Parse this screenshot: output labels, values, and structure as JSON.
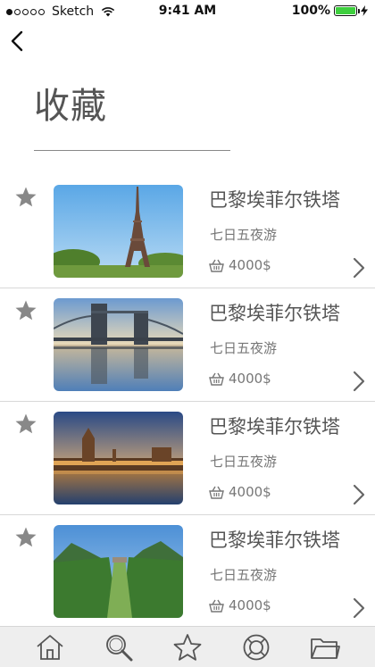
{
  "status_bar": {
    "carrier": "Sketch",
    "time": "9:41 AM",
    "battery": "100%",
    "signal_bars_filled": 1,
    "signal_bars_total": 5
  },
  "nav": {
    "back_icon": "chevron-left-icon"
  },
  "page": {
    "title": "收藏"
  },
  "items": [
    {
      "title": "巴黎埃菲尔铁塔",
      "subtitle": "七日五夜游",
      "price": "4000$",
      "image": "eiffel-tower-photo"
    },
    {
      "title": "巴黎埃菲尔铁塔",
      "subtitle": "七日五夜游",
      "price": "4000$",
      "image": "tower-bridge-photo"
    },
    {
      "title": "巴黎埃菲尔铁塔",
      "subtitle": "七日五夜游",
      "price": "4000$",
      "image": "westminster-palace-photo"
    },
    {
      "title": "巴黎埃菲尔铁塔",
      "subtitle": "七日五夜游",
      "price": "4000$",
      "image": "garden-valley-photo"
    }
  ],
  "tab_bar": {
    "tabs": [
      {
        "icon": "home-icon"
      },
      {
        "icon": "search-icon"
      },
      {
        "icon": "star-icon"
      },
      {
        "icon": "lifebuoy-icon"
      },
      {
        "icon": "folder-icon"
      }
    ]
  },
  "colors": {
    "battery_fill": "#3ecf3e",
    "star": "#888888",
    "tab_bar_bg": "#eeeeee"
  }
}
